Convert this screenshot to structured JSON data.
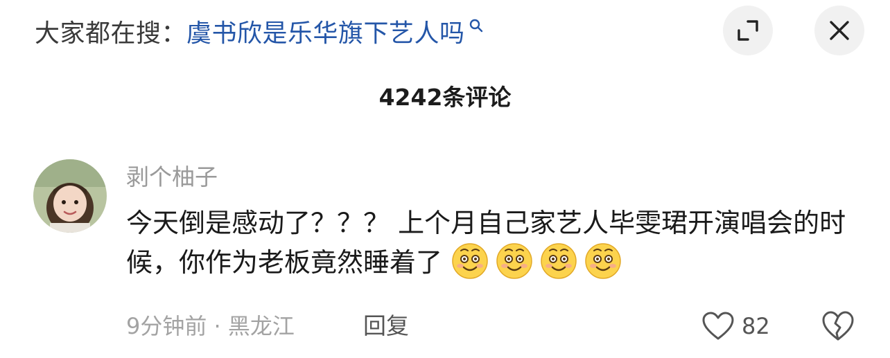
{
  "topbar": {
    "search_prefix": "大家都在搜：",
    "search_query": "虞书欣是乐华旗下艺人吗"
  },
  "comments_header": {
    "count_text": "4242条评论"
  },
  "comment": {
    "username": "剥个柚子",
    "text": "今天倒是感动了？？？ 上个月自己家艺人毕雯珺开演唱会的时候，你作为老板竟然睡着了",
    "emoji_names": [
      "smiling-face-emoji",
      "smiling-face-emoji",
      "smiling-face-emoji",
      "smiling-face-emoji"
    ],
    "meta": "9分钟前 · 黑龙江",
    "reply_label": "回复",
    "like_count": "82"
  },
  "colors": {
    "query_blue": "#2456a8",
    "muted_gray": "#9a9a9a",
    "button_bg": "#f1f1f1"
  }
}
